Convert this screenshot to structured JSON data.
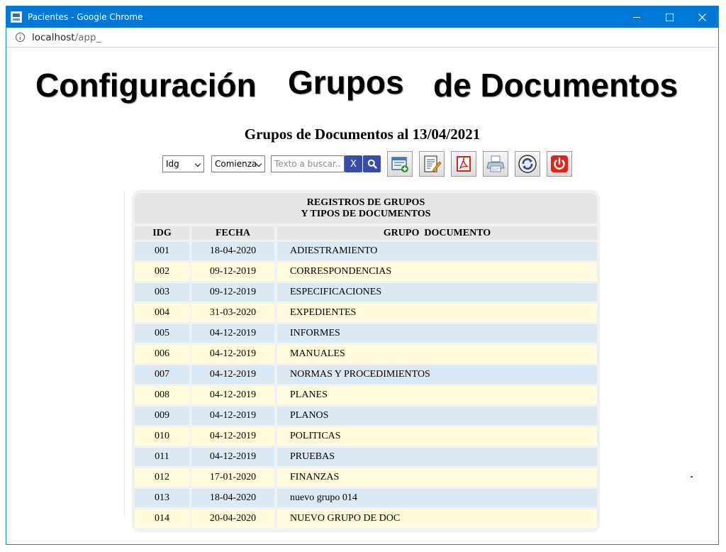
{
  "window": {
    "title": "Pacientes - Google Chrome",
    "url_host": "localhost",
    "url_rest": "/app_"
  },
  "page": {
    "title_parts": [
      "Configuración",
      "Grupos",
      "de Documentos"
    ],
    "subtitle": "Grupos de Documentos al 13/04/2021"
  },
  "toolbar": {
    "field_select": "Idg",
    "mode_select": "Comienza",
    "search_placeholder": "Texto a buscar..",
    "clear_label": "X"
  },
  "table": {
    "caption_line1": "REGISTROS DE GRUPOS",
    "caption_line2": "Y TIPOS DE DOCUMENTOS",
    "columns": [
      "IDG",
      "FECHA",
      "GRUPO  DOCUMENTO"
    ],
    "rows": [
      {
        "idg": "001",
        "fecha": "18-04-2020",
        "grupo": "ADIESTRAMIENTO"
      },
      {
        "idg": "002",
        "fecha": "09-12-2019",
        "grupo": "CORRESPONDENCIAS"
      },
      {
        "idg": "003",
        "fecha": "09-12-2019",
        "grupo": "ESPECIFICACIONES"
      },
      {
        "idg": "004",
        "fecha": "31-03-2020",
        "grupo": "EXPEDIENTES"
      },
      {
        "idg": "005",
        "fecha": "04-12-2019",
        "grupo": "INFORMES"
      },
      {
        "idg": "006",
        "fecha": "04-12-2019",
        "grupo": "MANUALES"
      },
      {
        "idg": "007",
        "fecha": "04-12-2019",
        "grupo": "NORMAS Y PROCEDIMIENTOS"
      },
      {
        "idg": "008",
        "fecha": "04-12-2019",
        "grupo": "PLANES"
      },
      {
        "idg": "009",
        "fecha": "04-12-2019",
        "grupo": "PLANOS"
      },
      {
        "idg": "010",
        "fecha": "04-12-2019",
        "grupo": "POLITICAS"
      },
      {
        "idg": "011",
        "fecha": "04-12-2019",
        "grupo": "PRUEBAS"
      },
      {
        "idg": "012",
        "fecha": "17-01-2020",
        "grupo": "FINANZAS"
      },
      {
        "idg": "013",
        "fecha": "18-04-2020",
        "grupo": "nuevo grupo 014"
      },
      {
        "idg": "014",
        "fecha": "20-04-2020",
        "grupo": "NUEVO GRUPO DE DOC"
      }
    ]
  },
  "colors": {
    "titlebar": "#0078d7",
    "row_odd": "#dbe9f4",
    "row_even": "#fffbdc",
    "search_button": "#3a4aa8"
  }
}
